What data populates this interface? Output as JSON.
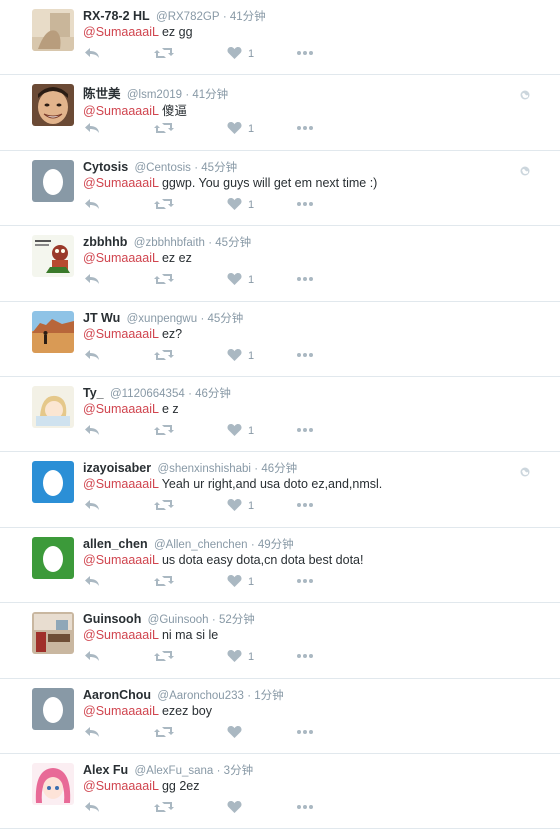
{
  "tweets": [
    {
      "name": "RX-78-2 HL",
      "handle": "@RX782GP",
      "time": "· 41分钟",
      "mention": "@SumaaaaiL",
      "text": " ez gg",
      "likes": "1",
      "globe": false,
      "avatar": "photo-pale"
    },
    {
      "name": "陈世美",
      "handle": "@lsm2019",
      "time": "· 41分钟",
      "mention": "@SumaaaaiL",
      "text": " 傻逼",
      "likes": "1",
      "globe": true,
      "avatar": "face"
    },
    {
      "name": "Cytosis",
      "handle": "@Centosis",
      "time": "· 45分钟",
      "mention": "@SumaaaaiL",
      "text": " ggwp. You guys will get em next time :)",
      "likes": "1",
      "globe": true,
      "avatar": "egg-gray"
    },
    {
      "name": "zbbhhb",
      "handle": "@zbbhhbfaith",
      "time": "· 45分钟",
      "mention": "@SumaaaaiL",
      "text": " ez ez",
      "likes": "1",
      "globe": false,
      "avatar": "cartoon"
    },
    {
      "name": "JT Wu",
      "handle": "@xunpengwu",
      "time": "· 45分钟",
      "mention": "@SumaaaaiL",
      "text": " ez?",
      "likes": "1",
      "globe": false,
      "avatar": "desert"
    },
    {
      "name": "Ty_",
      "handle": "@1120664354",
      "time": "· 46分钟",
      "mention": "@SumaaaaiL",
      "text": " e z",
      "likes": "1",
      "globe": false,
      "avatar": "anime-light"
    },
    {
      "name": "izayoisaber",
      "handle": "@shenxinshishabi",
      "time": "· 46分钟",
      "mention": "@SumaaaaiL",
      "text": " Yeah ur right,and usa doto ez,and,nmsl.",
      "likes": "1",
      "globe": true,
      "avatar": "egg-blue"
    },
    {
      "name": "allen_chen",
      "handle": "@Allen_chenchen",
      "time": "· 49分钟",
      "mention": "@SumaaaaiL",
      "text": " us dota easy dota,cn dota best dota!",
      "likes": "1",
      "globe": false,
      "avatar": "egg-green"
    },
    {
      "name": "Guinsooh",
      "handle": "@Guinsooh",
      "time": "· 52分钟",
      "mention": "@SumaaaaiL",
      "text": " ni ma si le",
      "likes": "1",
      "globe": false,
      "avatar": "room"
    },
    {
      "name": "AaronChou",
      "handle": "@Aaronchou233",
      "time": "· 1分钟",
      "mention": "@SumaaaaiL",
      "text": " ezez boy",
      "likes": "",
      "globe": false,
      "avatar": "egg-gray"
    },
    {
      "name": "Alex Fu",
      "handle": "@AlexFu_sana",
      "time": "· 3分钟",
      "mention": "@SumaaaaiL",
      "text": " gg 2ez",
      "likes": "",
      "globe": false,
      "avatar": "anime-pink"
    }
  ],
  "colors": {
    "mention": "#d0454f",
    "name": "#292f33",
    "meta": "#8899a6",
    "icon": "#aab8c2"
  }
}
